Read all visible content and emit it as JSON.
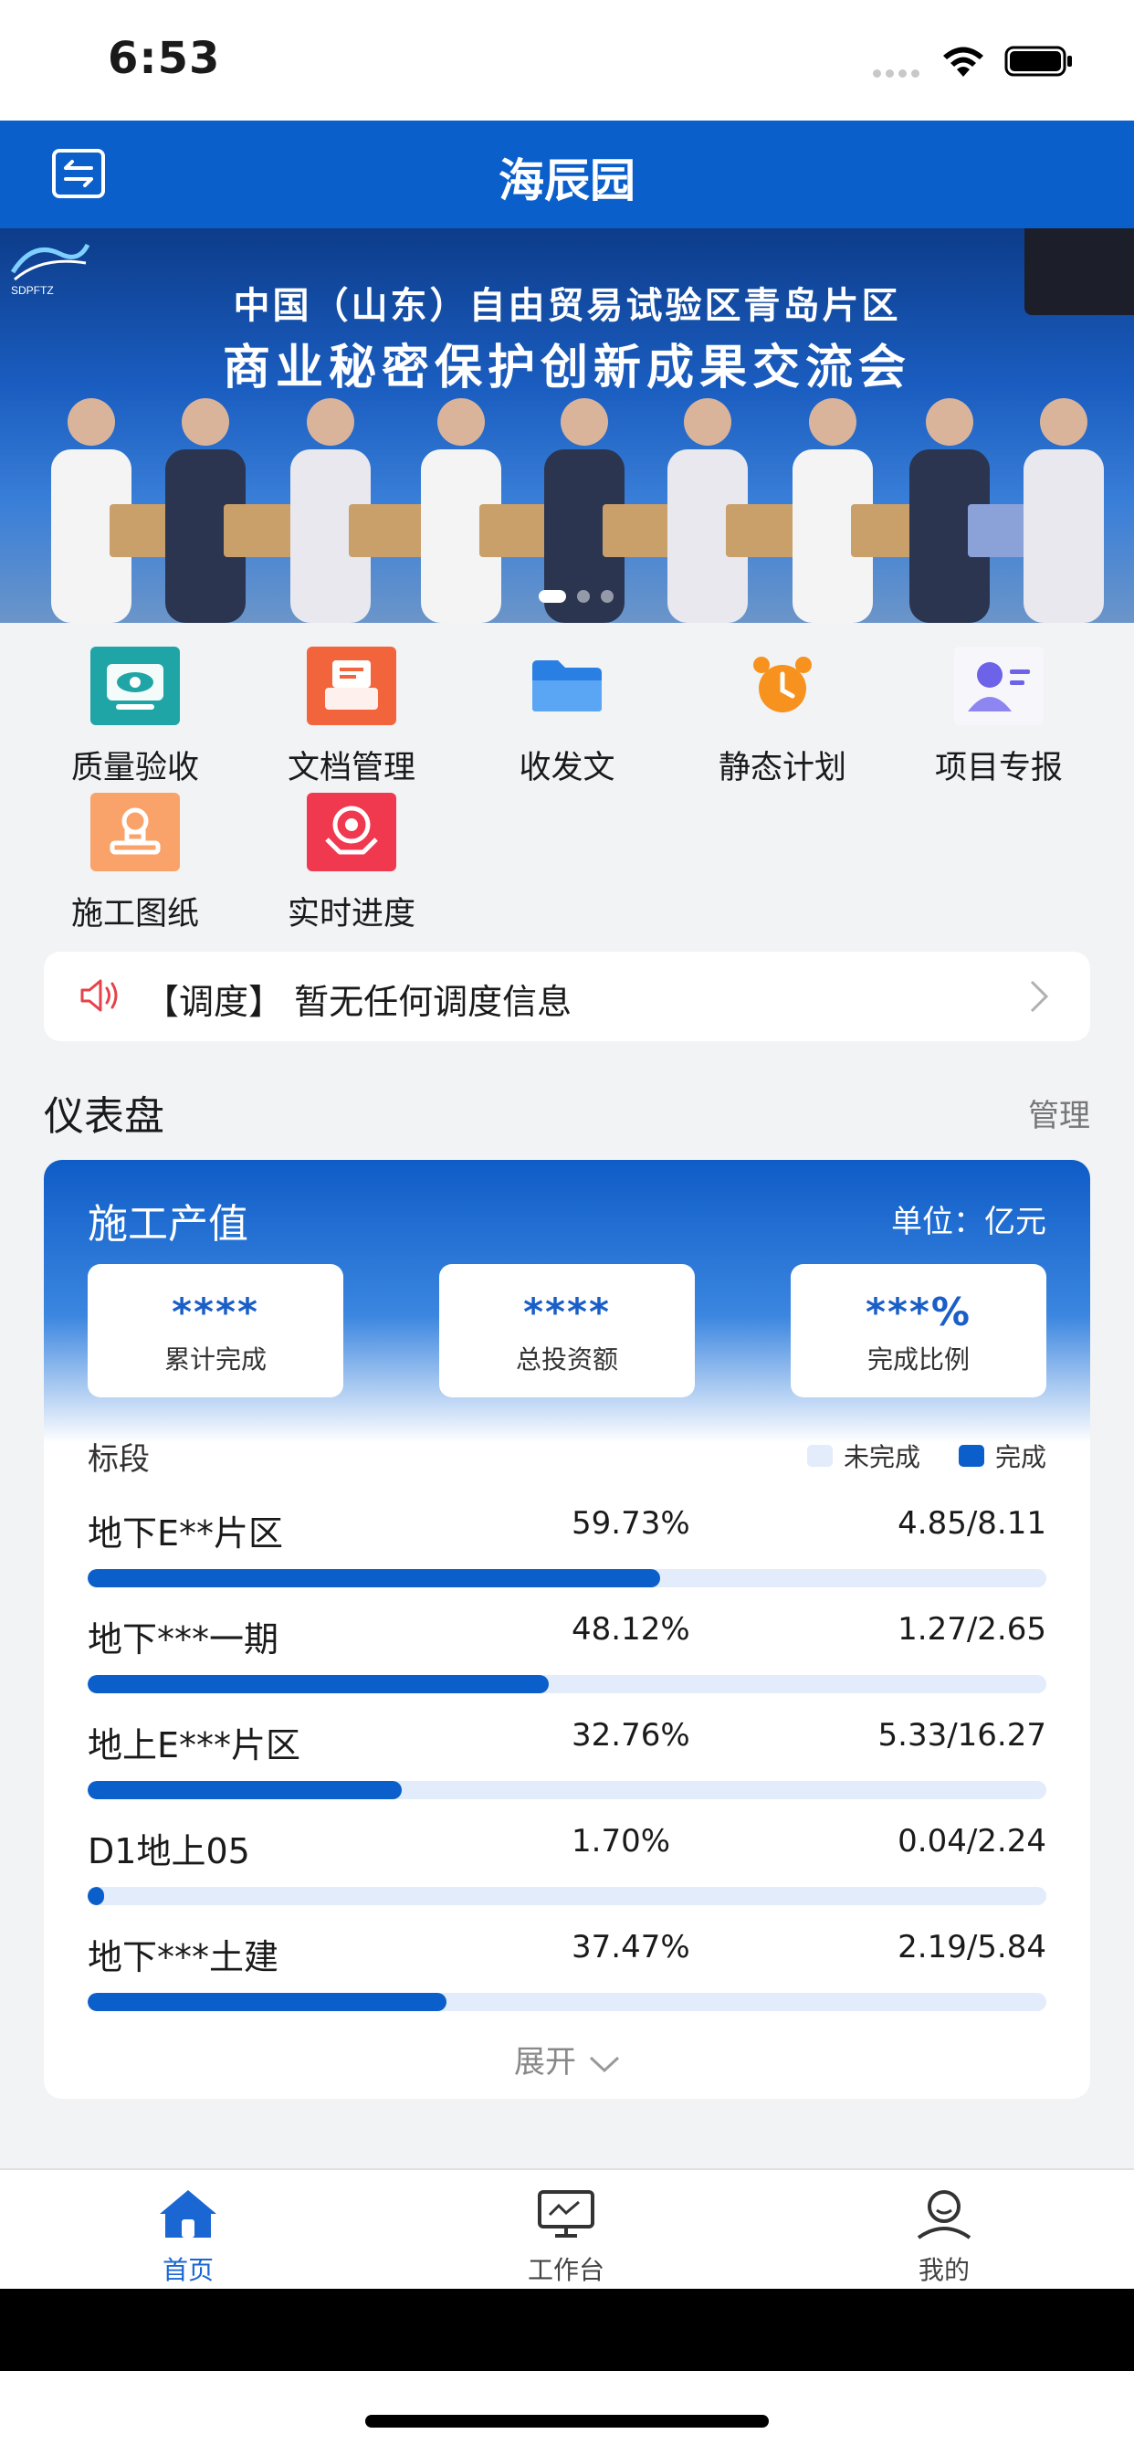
{
  "status_bar": {
    "time": "6:53"
  },
  "navbar": {
    "title": "海辰园"
  },
  "banner": {
    "line1": "中国（山东）自由贸易试验区青岛片区",
    "line2": "商业秘密保护创新成果交流会",
    "logo_text": "SDPFTZ",
    "page_count": 3,
    "active_page": 1
  },
  "shortcuts": [
    {
      "label": "质量验收",
      "icon": "eye-monitor-icon",
      "color": "#1fa5a6"
    },
    {
      "label": "文档管理",
      "icon": "document-stack-icon",
      "color": "#f2643c"
    },
    {
      "label": "收发文",
      "icon": "folder-icon",
      "color": "#2a7fe2"
    },
    {
      "label": "静态计划",
      "icon": "alarm-clock-icon",
      "color": "#f7921e"
    },
    {
      "label": "项目专报",
      "icon": "user-report-icon",
      "color": "#6d63e8"
    },
    {
      "label": "施工图纸",
      "icon": "stamp-icon",
      "color": "#f9a36a"
    },
    {
      "label": "实时进度",
      "icon": "target-hand-icon",
      "color": "#f0384f"
    }
  ],
  "notice": {
    "text": "【调度】 暂无任何调度信息"
  },
  "dashboard": {
    "title": "仪表盘",
    "manage_label": "管理",
    "card": {
      "title": "施工产值",
      "unit": "单位：亿元",
      "stats": [
        {
          "value": "****",
          "label": "累计完成"
        },
        {
          "value": "****",
          "label": "总投资额"
        },
        {
          "value": "***%",
          "label": "完成比例"
        }
      ],
      "segment_label": "标段",
      "legend": [
        {
          "label": "未完成",
          "color": "#e3ecfa"
        },
        {
          "label": "完成",
          "color": "#0a5fcb"
        }
      ],
      "rows": [
        {
          "name": "地下E**片区",
          "percent_text": "59.73%",
          "ratio": "4.85/8.11",
          "progress": 0.5973
        },
        {
          "name": "地下***一期",
          "percent_text": "48.12%",
          "ratio": "1.27/2.65",
          "progress": 0.4812
        },
        {
          "name": "地上E***片区",
          "percent_text": "32.76%",
          "ratio": "5.33/16.27",
          "progress": 0.3276
        },
        {
          "name": "D1地上05",
          "percent_text": "1.70%",
          "ratio": "0.04/2.24",
          "progress": 0.017
        },
        {
          "name": "地下***土建",
          "percent_text": "37.47%",
          "ratio": "2.19/5.84",
          "progress": 0.3747
        }
      ],
      "expand_label": "展开"
    }
  },
  "tabbar": [
    {
      "label": "首页",
      "icon": "home-icon",
      "active": true
    },
    {
      "label": "工作台",
      "icon": "monitor-icon",
      "active": false
    },
    {
      "label": "我的",
      "icon": "profile-icon",
      "active": false
    }
  ]
}
